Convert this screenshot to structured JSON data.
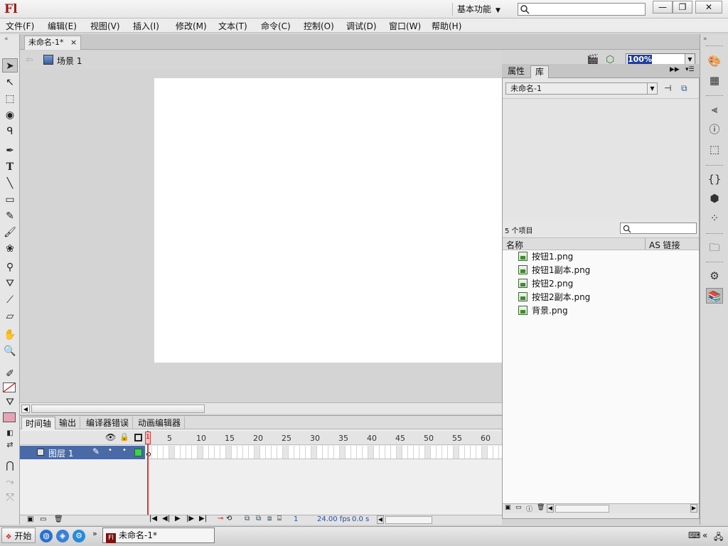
{
  "app": {
    "logo_text": "Fl",
    "workspace_label": "基本功能",
    "search_placeholder": ""
  },
  "window_buttons": {
    "minimize": "—",
    "restore": "❐",
    "close": "✕"
  },
  "menu": [
    "文件(F)",
    "编辑(E)",
    "视图(V)",
    "插入(I)",
    "修改(M)",
    "文本(T)",
    "命令(C)",
    "控制(O)",
    "调试(D)",
    "窗口(W)",
    "帮助(H)"
  ],
  "document": {
    "tab_title": "未命名-1*",
    "tab_close": "×",
    "scene_label": "场景 1",
    "zoom": "100%"
  },
  "timeline": {
    "tabs": [
      "时间轴",
      "输出",
      "编译器错误",
      "动画编辑器"
    ],
    "frame_numbers": [
      "1",
      "5",
      "10",
      "15",
      "20",
      "25",
      "30",
      "35",
      "40",
      "45",
      "50",
      "55",
      "60"
    ],
    "layer_name": "图层 1",
    "current_frame": "1",
    "fps": "24.00 fps",
    "time": "0.0 s"
  },
  "library": {
    "tabs": [
      "属性",
      "库"
    ],
    "doc_select": "未命名-1",
    "item_count": "5 个项目",
    "col_name": "名称",
    "col_link": "AS 链接",
    "items": [
      "按钮1.png",
      "按钮1副本.png",
      "按钮2.png",
      "按钮2副本.png",
      "背景.png"
    ]
  },
  "taskbar": {
    "start_label": "开始",
    "task_label": "未命名-1*"
  }
}
